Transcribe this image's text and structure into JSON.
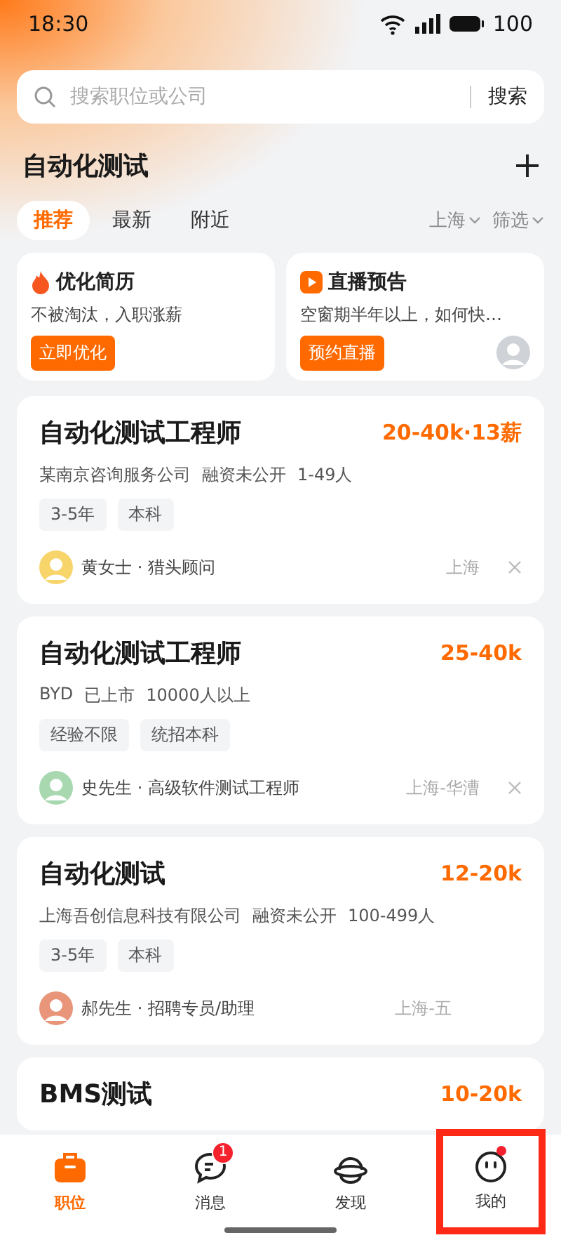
{
  "status_bar": {
    "time": "18:30",
    "battery": "100"
  },
  "search": {
    "placeholder": "搜索职位或公司",
    "button": "搜索"
  },
  "header": {
    "title": "自动化测试"
  },
  "filter_tabs": [
    {
      "label": "推荐",
      "selected": true
    },
    {
      "label": "最新",
      "selected": false
    },
    {
      "label": "附近",
      "selected": false
    }
  ],
  "filters": [
    {
      "label": "上海"
    },
    {
      "label": "筛选"
    }
  ],
  "promos": [
    {
      "kind": "resume",
      "title": "优化简历",
      "subtitle": "不被淘汰，入职涨薪",
      "button": "立即优化"
    },
    {
      "kind": "live",
      "title": "直播预告",
      "subtitle": "空窗期半年以上，如何快…",
      "button": "预约直播"
    }
  ],
  "jobs": [
    {
      "title": "自动化测试工程师",
      "salary": "20-40k·13薪",
      "company": [
        "某南京咨询服务公司",
        "融资未公开",
        "1-49人"
      ],
      "tags": [
        "3-5年",
        "本科"
      ],
      "recruiter": "黄女士 · 猎头顾问",
      "color": "#f7d56b",
      "location": "上海",
      "covered": false
    },
    {
      "title": "自动化测试工程师",
      "salary": "25-40k",
      "company": [
        "BYD",
        "已上市",
        "10000人以上"
      ],
      "tags": [
        "经验不限",
        "统招本科"
      ],
      "recruiter": "史先生 · 高级软件测试工程师",
      "color": "#a8d8b0",
      "location": "上海-华漕",
      "covered": false
    },
    {
      "title": "自动化测试",
      "salary": "12-20k",
      "company": [
        "上海吾创信息科技有限公司",
        "融资未公开",
        "100-499人"
      ],
      "tags": [
        "3-5年",
        "本科"
      ],
      "recruiter": "郝先生 · 招聘专员/助理",
      "color": "#e8957a",
      "location": "上海-五",
      "covered": true
    },
    {
      "title": "BMS测试",
      "salary": "10-20k"
    }
  ],
  "nav": [
    {
      "label": "职位",
      "kind": "briefcase",
      "selected": true,
      "dot": false,
      "highlighted": false
    },
    {
      "label": "消息",
      "kind": "chat",
      "selected": false,
      "badge": "1",
      "dot": false,
      "highlighted": false
    },
    {
      "label": "发现",
      "kind": "planet",
      "selected": false,
      "dot": false,
      "highlighted": false
    },
    {
      "label": "我的",
      "kind": "face",
      "selected": false,
      "dot": true,
      "highlighted": true
    }
  ]
}
